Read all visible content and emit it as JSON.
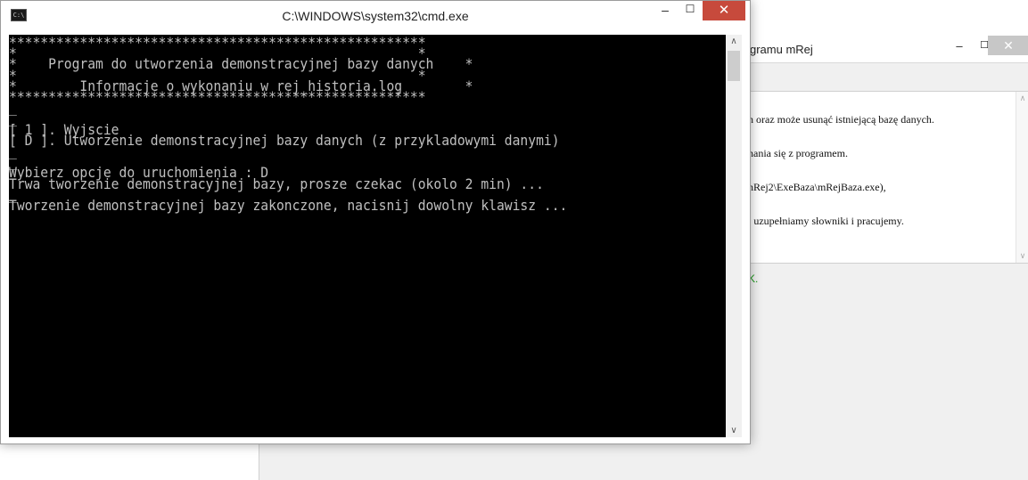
{
  "background_window": {
    "title": "gramu mRej",
    "minimize_glyph": "–",
    "maximize_glyph": "☐",
    "close_glyph": "✕",
    "text_lines": [
      "h oraz może usunąć istniejącą bazę danych.",
      "nania się z programem.",
      "nRej2\\ExeBaza\\mRejBaza.exe),",
      "j uzupełniamy słowniki i pracujemy."
    ],
    "status_text": "K.",
    "status_color": "#1a9a1a"
  },
  "cmd_window": {
    "title": "C:\\WINDOWS\\system32\\cmd.exe",
    "icon_label": "C:\\",
    "minimize_glyph": "–",
    "maximize_glyph": "☐",
    "close_glyph": "✕",
    "close_color": "#c74a3c",
    "console_lines": [
      "*****************************************************",
      "*                                                   *",
      "*    Program do utworzenia demonstracyjnej bazy danych    *",
      "*                                                   *",
      "*        Informacje o wykonaniu w rej_historia.log        *",
      "*****************************************************",
      "_",
      "_",
      "[ 1 ]. Wyjscie",
      "[ D ]. Utworzenie demonstracyjnej bazy danych (z przykladowymi danymi)",
      "_",
      "_",
      "Wybierz opcje do uruchomienia : D",
      "Trwa tworzenie demonstracyjnej bazy, prosze czekac (okolo 2 min) ...",
      "_",
      "Tworzenie demonstracyjnej bazy zakonczone, nacisnij dowolny klawisz ..."
    ],
    "scroll_up_glyph": "∧",
    "scroll_down_glyph": "∨"
  }
}
